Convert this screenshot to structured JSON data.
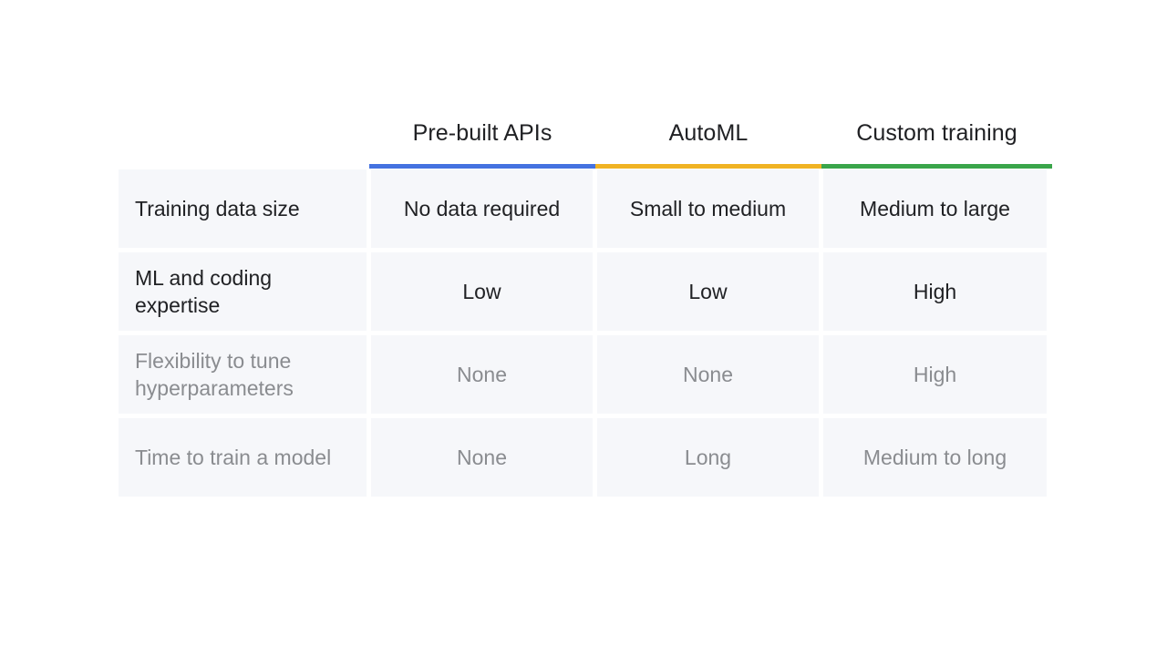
{
  "table": {
    "columns": [
      {
        "label": "Pre-built APIs",
        "accent": "#4472e0"
      },
      {
        "label": "AutoML",
        "accent": "#f0b323"
      },
      {
        "label": "Custom training",
        "accent": "#3aa54a"
      }
    ],
    "rows": [
      {
        "label": "Training data size",
        "values": [
          "No data required",
          "Small to medium",
          "Medium to large"
        ],
        "emphasis": "normal"
      },
      {
        "label": "ML and coding expertise",
        "values": [
          "Low",
          "Low",
          "High"
        ],
        "emphasis": "normal"
      },
      {
        "label": "Flexibility to tune hyperparameters",
        "values": [
          "None",
          "None",
          "High"
        ],
        "emphasis": "muted"
      },
      {
        "label": "Time to train a model",
        "values": [
          "None",
          "Long",
          "Medium to long"
        ],
        "emphasis": "muted"
      }
    ]
  }
}
